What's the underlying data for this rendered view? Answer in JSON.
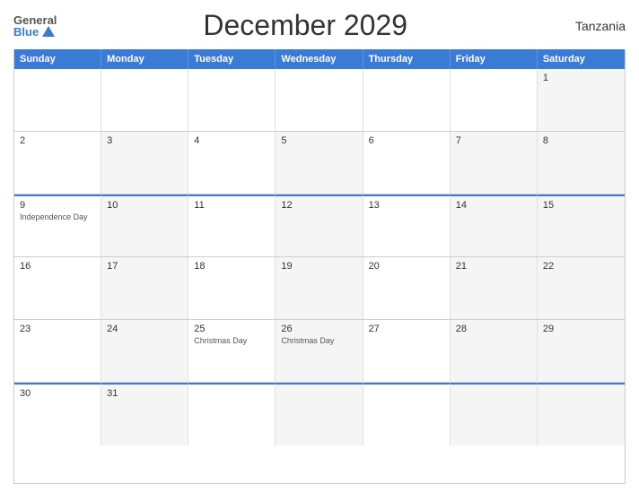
{
  "header": {
    "logo_general": "General",
    "logo_blue": "Blue",
    "title": "December 2029",
    "country": "Tanzania"
  },
  "weekdays": [
    "Sunday",
    "Monday",
    "Tuesday",
    "Wednesday",
    "Thursday",
    "Friday",
    "Saturday"
  ],
  "rows": [
    {
      "cells": [
        {
          "day": "",
          "holiday": "",
          "gray": false,
          "topBorder": false
        },
        {
          "day": "",
          "holiday": "",
          "gray": false,
          "topBorder": false
        },
        {
          "day": "",
          "holiday": "",
          "gray": false,
          "topBorder": false
        },
        {
          "day": "",
          "holiday": "",
          "gray": false,
          "topBorder": false
        },
        {
          "day": "",
          "holiday": "",
          "gray": false,
          "topBorder": false
        },
        {
          "day": "",
          "holiday": "",
          "gray": false,
          "topBorder": false
        },
        {
          "day": "1",
          "holiday": "",
          "gray": true,
          "topBorder": false
        }
      ]
    },
    {
      "cells": [
        {
          "day": "2",
          "holiday": "",
          "gray": false,
          "topBorder": false
        },
        {
          "day": "3",
          "holiday": "",
          "gray": true,
          "topBorder": false
        },
        {
          "day": "4",
          "holiday": "",
          "gray": false,
          "topBorder": false
        },
        {
          "day": "5",
          "holiday": "",
          "gray": true,
          "topBorder": false
        },
        {
          "day": "6",
          "holiday": "",
          "gray": false,
          "topBorder": false
        },
        {
          "day": "7",
          "holiday": "",
          "gray": true,
          "topBorder": false
        },
        {
          "day": "8",
          "holiday": "",
          "gray": true,
          "topBorder": false
        }
      ]
    },
    {
      "cells": [
        {
          "day": "9",
          "holiday": "Independence Day",
          "gray": false,
          "topBorder": true
        },
        {
          "day": "10",
          "holiday": "",
          "gray": true,
          "topBorder": true
        },
        {
          "day": "11",
          "holiday": "",
          "gray": false,
          "topBorder": true
        },
        {
          "day": "12",
          "holiday": "",
          "gray": true,
          "topBorder": true
        },
        {
          "day": "13",
          "holiday": "",
          "gray": false,
          "topBorder": true
        },
        {
          "day": "14",
          "holiday": "",
          "gray": true,
          "topBorder": true
        },
        {
          "day": "15",
          "holiday": "",
          "gray": true,
          "topBorder": true
        }
      ]
    },
    {
      "cells": [
        {
          "day": "16",
          "holiday": "",
          "gray": false,
          "topBorder": false
        },
        {
          "day": "17",
          "holiday": "",
          "gray": true,
          "topBorder": false
        },
        {
          "day": "18",
          "holiday": "",
          "gray": false,
          "topBorder": false
        },
        {
          "day": "19",
          "holiday": "",
          "gray": true,
          "topBorder": false
        },
        {
          "day": "20",
          "holiday": "",
          "gray": false,
          "topBorder": false
        },
        {
          "day": "21",
          "holiday": "",
          "gray": true,
          "topBorder": false
        },
        {
          "day": "22",
          "holiday": "",
          "gray": true,
          "topBorder": false
        }
      ]
    },
    {
      "cells": [
        {
          "day": "23",
          "holiday": "",
          "gray": false,
          "topBorder": false
        },
        {
          "day": "24",
          "holiday": "",
          "gray": true,
          "topBorder": false
        },
        {
          "day": "25",
          "holiday": "Christmas Day",
          "gray": false,
          "topBorder": false
        },
        {
          "day": "26",
          "holiday": "Christmas Day",
          "gray": true,
          "topBorder": false
        },
        {
          "day": "27",
          "holiday": "",
          "gray": false,
          "topBorder": false
        },
        {
          "day": "28",
          "holiday": "",
          "gray": true,
          "topBorder": false
        },
        {
          "day": "29",
          "holiday": "",
          "gray": true,
          "topBorder": false
        }
      ]
    },
    {
      "cells": [
        {
          "day": "30",
          "holiday": "",
          "gray": false,
          "topBorder": true
        },
        {
          "day": "31",
          "holiday": "",
          "gray": true,
          "topBorder": true
        },
        {
          "day": "",
          "holiday": "",
          "gray": false,
          "topBorder": true
        },
        {
          "day": "",
          "holiday": "",
          "gray": true,
          "topBorder": true
        },
        {
          "day": "",
          "holiday": "",
          "gray": false,
          "topBorder": true
        },
        {
          "day": "",
          "holiday": "",
          "gray": true,
          "topBorder": true
        },
        {
          "day": "",
          "holiday": "",
          "gray": true,
          "topBorder": true
        }
      ]
    }
  ]
}
